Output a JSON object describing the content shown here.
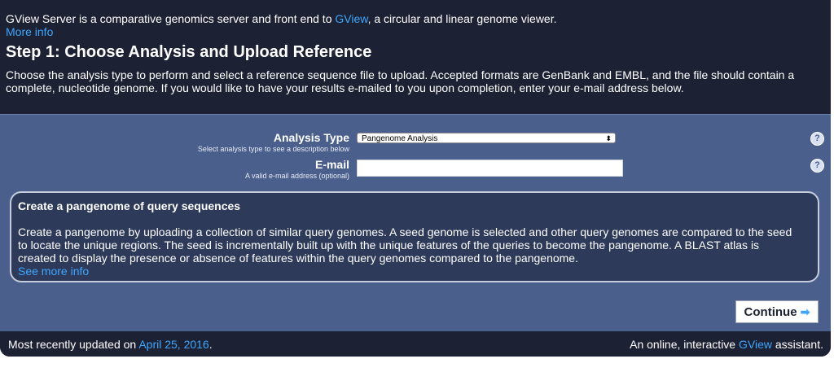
{
  "header": {
    "intro_prefix": "GView Server is a comparative genomics server and front end to ",
    "intro_link": "GView",
    "intro_suffix": ", a circular and linear genome viewer.",
    "more_info": "More info",
    "step_title": "Step 1: Choose Analysis and Upload Reference",
    "step_desc": "Choose the analysis type to perform and select a reference sequence file to upload. Accepted formats are GenBank and EMBL, and the file should contain a complete, nucleotide genome. If you would like to have your results e-mailed to you upon completion, enter your e-mail address below."
  },
  "form": {
    "analysis_label": "Analysis Type",
    "analysis_hint": "Select analysis type to see a description below",
    "analysis_value": "Pangenome Analysis",
    "email_label": "E-mail",
    "email_hint": "A valid e-mail address (optional)",
    "email_value": "",
    "help_glyph": "?"
  },
  "description": {
    "title": "Create a pangenome of query sequences",
    "text": "Create a pangenome by uploading a collection of similar query genomes. A seed genome is selected and other query genomes are compared to the seed to locate the unique regions. The seed is incrementally built up with the unique features of the queries to become the pangenome. A BLAST atlas is created to display the presence or absence of features within the query genomes compared to the pangenome.",
    "see_more": "See more info"
  },
  "actions": {
    "continue_label": "Continue",
    "continue_icon": "arrow-right-icon"
  },
  "footer": {
    "updated_prefix": "Most recently updated on ",
    "updated_date": "April 25, 2016",
    "updated_suffix": ".",
    "tagline_prefix": "An online, interactive ",
    "tagline_link": "GView",
    "tagline_suffix": " assistant."
  },
  "colors": {
    "dark_bg": "#1c2233",
    "form_bg": "#4a5f8c",
    "box_bg": "#2e3a5a",
    "link": "#3ea6ff"
  }
}
